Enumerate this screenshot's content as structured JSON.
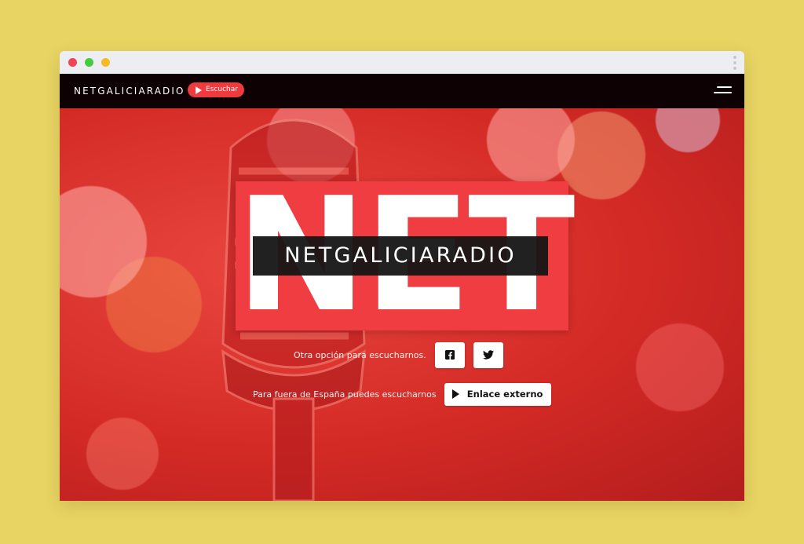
{
  "navbar": {
    "brand": "NETGALICIARADIO",
    "listen_label": "Escuchar"
  },
  "hero": {
    "logo_big": "NET",
    "logo_sub": "NETGALICIARADIO",
    "alt_listen_text": "Otra opción para escucharnos.",
    "outside_spain_text": "Para fuera de España puedes escucharnos",
    "external_link_label": "Enlace externo"
  },
  "colors": {
    "background": "#e8d462",
    "navbar": "#0e0104",
    "accent": "#ef3a3f",
    "hero_red": "#d42a25"
  },
  "icons": [
    "play-icon",
    "menu-icon",
    "facebook-icon",
    "twitter-icon"
  ]
}
